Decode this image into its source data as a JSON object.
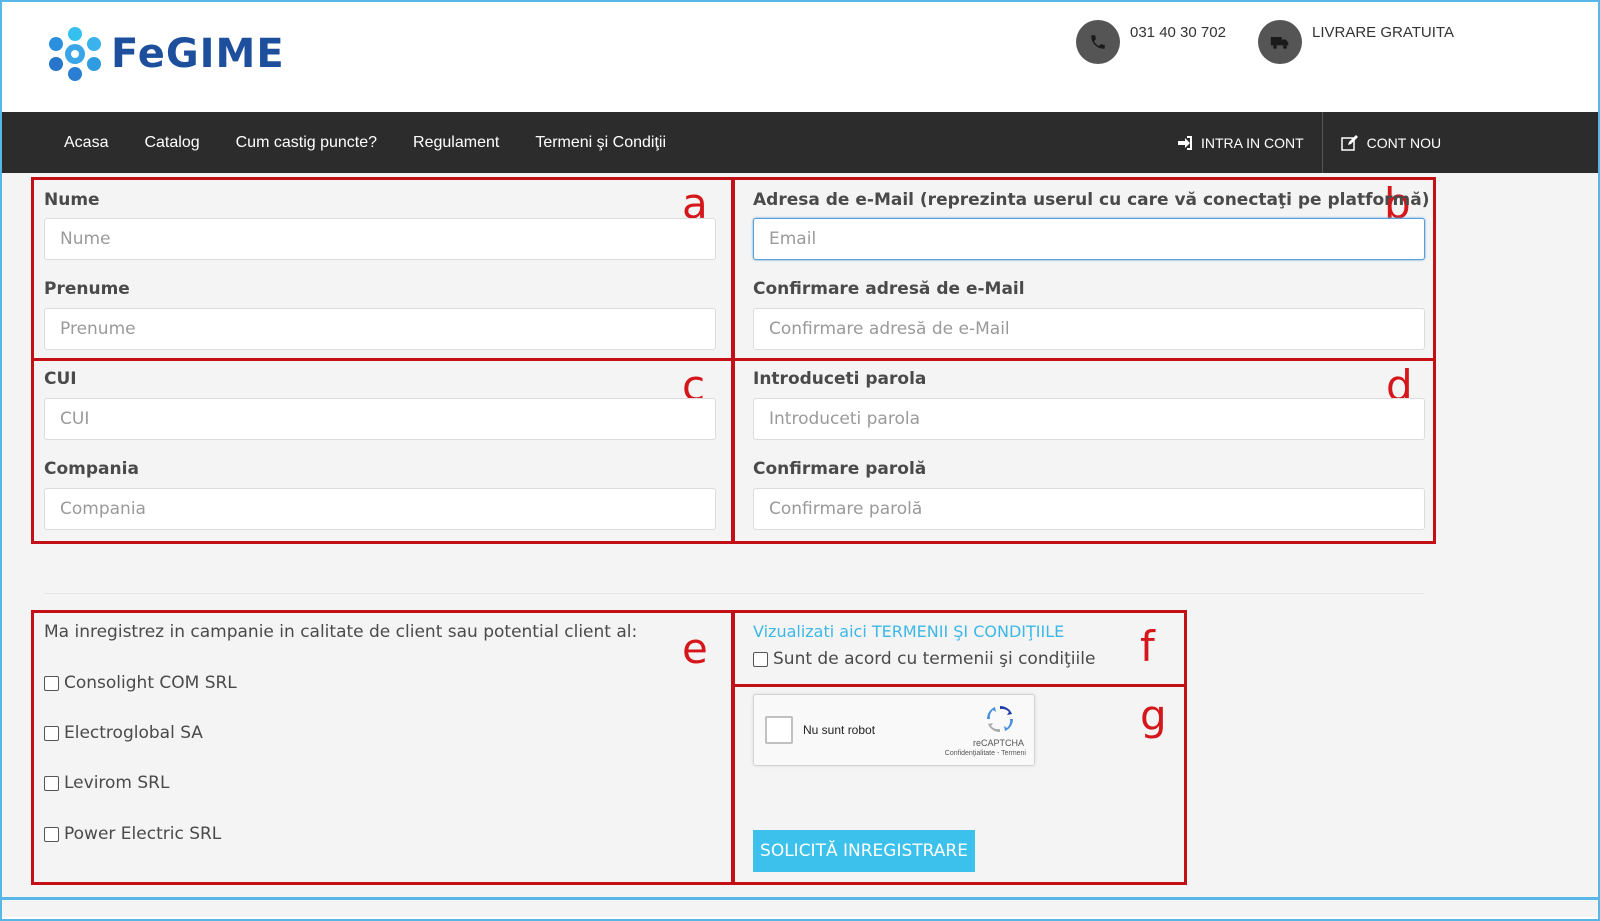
{
  "header": {
    "logo_text": "FeGIME",
    "phone": "031 40 30 702",
    "shipping": "LIVRARE GRATUITA"
  },
  "nav": {
    "items": [
      "Acasa",
      "Catalog",
      "Cum castig puncte?",
      "Regulament",
      "Termeni şi Condiţii"
    ],
    "login": "INTRA IN CONT",
    "register": "CONT NOU"
  },
  "form": {
    "nume": {
      "label": "Nume",
      "placeholder": "Nume"
    },
    "prenume": {
      "label": "Prenume",
      "placeholder": "Prenume"
    },
    "email": {
      "label": "Adresa de e-Mail (reprezinta userul cu care vă conectaţi pe platformă)",
      "placeholder": "Email"
    },
    "email_confirm": {
      "label": "Confirmare adresă de e-Mail",
      "placeholder": "Confirmare adresă de e-Mail"
    },
    "cui": {
      "label": "CUI",
      "placeholder": "CUI"
    },
    "compania": {
      "label": "Compania",
      "placeholder": "Compania"
    },
    "parola": {
      "label": "Introduceti parola",
      "placeholder": "Introduceti parola"
    },
    "parola_confirm": {
      "label": "Confirmare parolă",
      "placeholder": "Confirmare parolă"
    },
    "campaign_label": "Ma inregistrez in campanie in calitate de client sau potential client al:",
    "companies": [
      "Consolight COM SRL",
      "Electroglobal SA",
      "Levirom SRL",
      "Power Electric SRL"
    ],
    "terms_link": "Vizualizati aici TERMENII ŞI CONDIŢIILE",
    "terms_agree": "Sunt de acord cu termenii şi condiţiile",
    "captcha_text": "Nu sunt robot",
    "captcha_brand": "reCAPTCHA",
    "captcha_privacy": "Confidenţialitate - Termeni",
    "submit": "SOLICITĂ INREGISTRARE"
  },
  "annotations": {
    "a": "a",
    "b": "b",
    "c": "c",
    "d": "d",
    "e": "e",
    "f": "f",
    "g": "g"
  },
  "colors": {
    "annotation_red": "#c30f16",
    "nav_bg": "#2c2c2c",
    "accent_blue": "#3cc0ec",
    "brand_blue": "#1d4f9c"
  }
}
